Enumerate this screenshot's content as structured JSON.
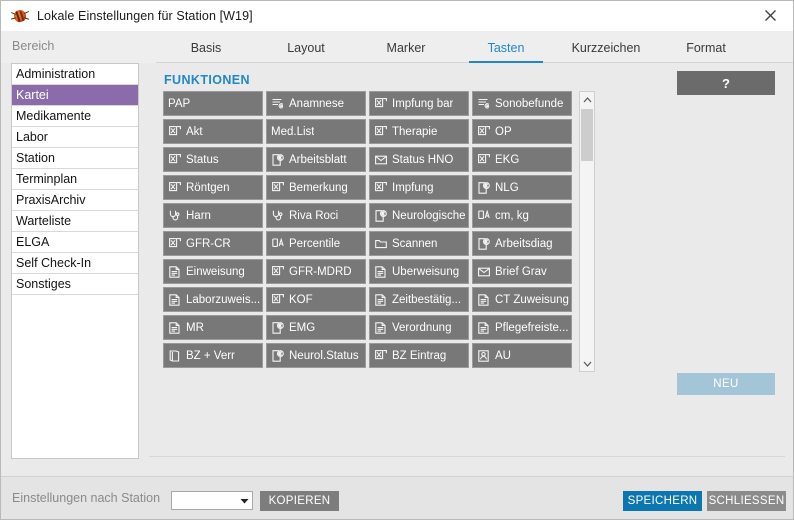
{
  "window": {
    "title": "Lokale Einstellungen für Station [W19]",
    "app_icon": "bug-icon",
    "close_icon": "close-icon"
  },
  "subheader": {
    "bereich_label": "Bereich"
  },
  "tabs": {
    "active": "Tasten",
    "items": [
      {
        "label": "Basis"
      },
      {
        "label": "Layout"
      },
      {
        "label": "Marker"
      },
      {
        "label": "Tasten"
      },
      {
        "label": "Kurzzeichen"
      },
      {
        "label": "Format"
      }
    ]
  },
  "sidebar": {
    "selected": "Kartei",
    "items": [
      {
        "label": "Administration"
      },
      {
        "label": "Kartei"
      },
      {
        "label": "Medikamente"
      },
      {
        "label": "Labor"
      },
      {
        "label": "Station"
      },
      {
        "label": "Terminplan"
      },
      {
        "label": "PraxisArchiv"
      },
      {
        "label": "Warteliste"
      },
      {
        "label": "ELGA"
      },
      {
        "label": "Self Check-In"
      },
      {
        "label": "Sonstiges"
      }
    ]
  },
  "content": {
    "section_title": "FUNKTIONEN",
    "help_label": "?",
    "neu_label": "NEU",
    "scrollbar": {
      "up_icon": "chevron-up-icon",
      "down_icon": "chevron-down-icon",
      "thumb_icon": "scroll-thumb"
    },
    "buttons": [
      {
        "label": "PAP",
        "icon": "none"
      },
      {
        "label": "Anamnese",
        "icon": "list-euro-icon"
      },
      {
        "label": "Impfung bar",
        "icon": "image-text-icon"
      },
      {
        "label": "Sonobefunde",
        "icon": "list-euro-icon"
      },
      {
        "label": "Akt",
        "icon": "image-text-icon"
      },
      {
        "label": "Med.List",
        "icon": "none"
      },
      {
        "label": "Therapie",
        "icon": "image-text-icon"
      },
      {
        "label": "OP",
        "icon": "image-text-icon"
      },
      {
        "label": "Status",
        "icon": "image-text-icon"
      },
      {
        "label": "Arbeitsblatt",
        "icon": "page-euro-icon"
      },
      {
        "label": "Status HNO",
        "icon": "envelope-icon"
      },
      {
        "label": "EKG",
        "icon": "image-text-icon"
      },
      {
        "label": "Röntgen",
        "icon": "image-text-icon"
      },
      {
        "label": "Bemerkung",
        "icon": "image-text-icon"
      },
      {
        "label": "Impfung",
        "icon": "image-text-icon"
      },
      {
        "label": "NLG",
        "icon": "page-euro-icon"
      },
      {
        "label": "Harn",
        "icon": "stethoscope-icon"
      },
      {
        "label": "Riva Roci",
        "icon": "stethoscope-icon"
      },
      {
        "label": "Neurologische",
        "icon": "page-euro-icon"
      },
      {
        "label": "cm, kg",
        "icon": "ruler-icon"
      },
      {
        "label": "GFR-CR",
        "icon": "image-text-icon"
      },
      {
        "label": "Percentile",
        "icon": "ruler-icon"
      },
      {
        "label": "Scannen",
        "icon": "folder-icon"
      },
      {
        "label": "Arbeitsdiag",
        "icon": "page-euro-icon"
      },
      {
        "label": "Einweisung",
        "icon": "form-icon"
      },
      {
        "label": "GFR-MDRD",
        "icon": "image-text-icon"
      },
      {
        "label": "Überweisung",
        "icon": "form-icon"
      },
      {
        "label": "Brief Grav",
        "icon": "envelope-icon"
      },
      {
        "label": "Laborzuweis...",
        "icon": "form-icon"
      },
      {
        "label": "KOF",
        "icon": "image-text-icon"
      },
      {
        "label": "Zeitbestätig...",
        "icon": "form-icon"
      },
      {
        "label": "CT Zuweisung",
        "icon": "form-icon"
      },
      {
        "label": "MR",
        "icon": "form-icon"
      },
      {
        "label": "EMG",
        "icon": "page-euro-icon"
      },
      {
        "label": "Verordnung",
        "icon": "form-icon"
      },
      {
        "label": "Pflegefreiste...",
        "icon": "form-icon"
      },
      {
        "label": "BZ + Verr",
        "icon": "book-icon"
      },
      {
        "label": "Neurol.Status",
        "icon": "page-euro-icon"
      },
      {
        "label": "BZ Eintrag",
        "icon": "image-text-icon"
      },
      {
        "label": "AU",
        "icon": "badge-icon"
      }
    ]
  },
  "footer": {
    "label": "Einstellungen nach Station",
    "station_value": "",
    "station_caret": "chevron-down-icon",
    "kopieren_label": "KOPIEREN",
    "speichern_label": "SPEICHERN",
    "schliessen_label": "SCHLIESSEN"
  },
  "colors": {
    "accent_blue": "#2386c8",
    "save_blue": "#0b76b0",
    "selection_purple": "#8b6ba9",
    "button_gray": "#787878",
    "neu_blue": "#a4c4d8"
  }
}
